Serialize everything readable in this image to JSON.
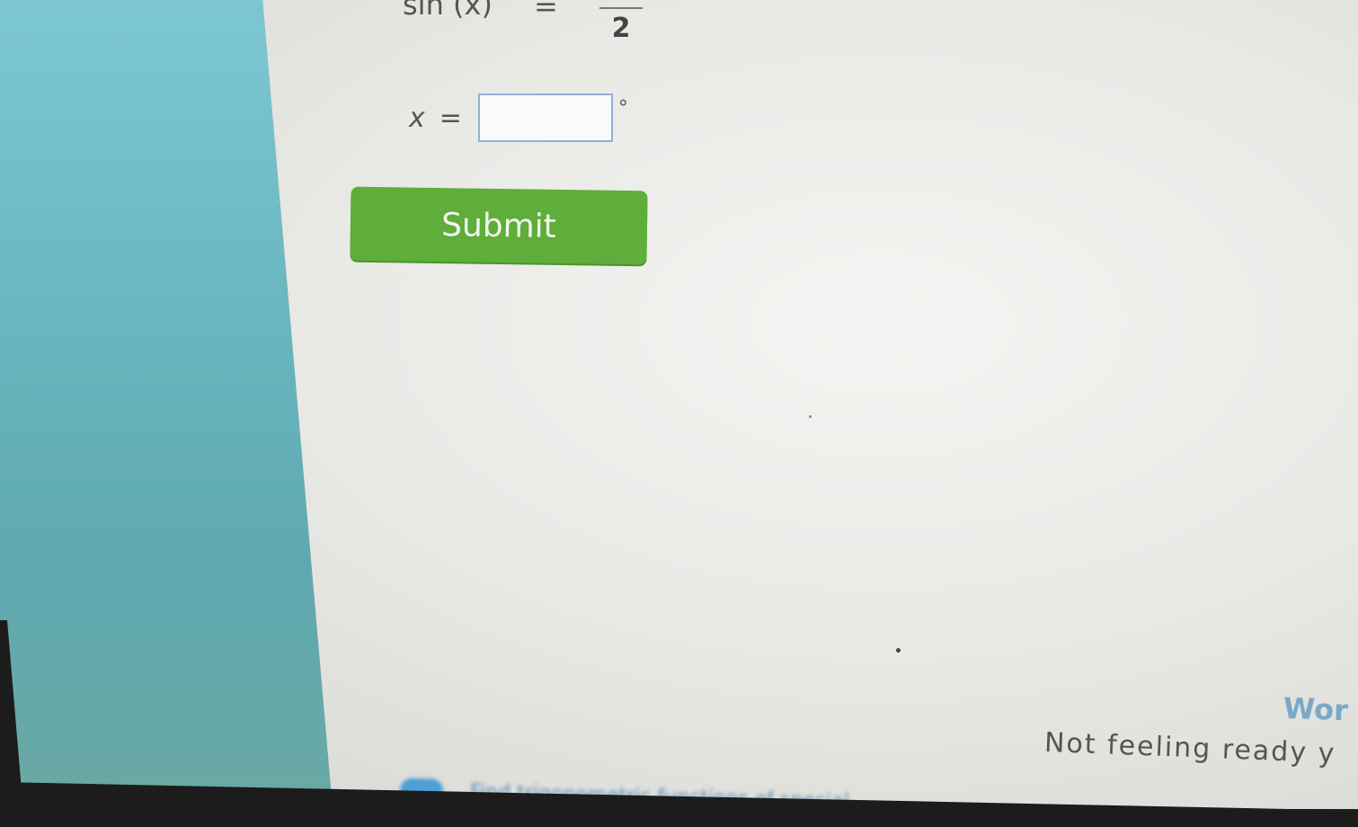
{
  "equation": {
    "lhs": "sin (x)",
    "equals": "=",
    "denominator": "2"
  },
  "answer": {
    "variable": "x",
    "equals": "=",
    "value": "",
    "placeholder": "",
    "unit": "°"
  },
  "submit": {
    "label": "Submit"
  },
  "footer": {
    "work_link": "Wor",
    "not_ready": "Not feeling ready y",
    "hint": "Find trigonometric functions of special"
  },
  "colors": {
    "sidebar": "#6bb8c2",
    "submit": "#5fad3a",
    "link": "#7aa8c9"
  }
}
